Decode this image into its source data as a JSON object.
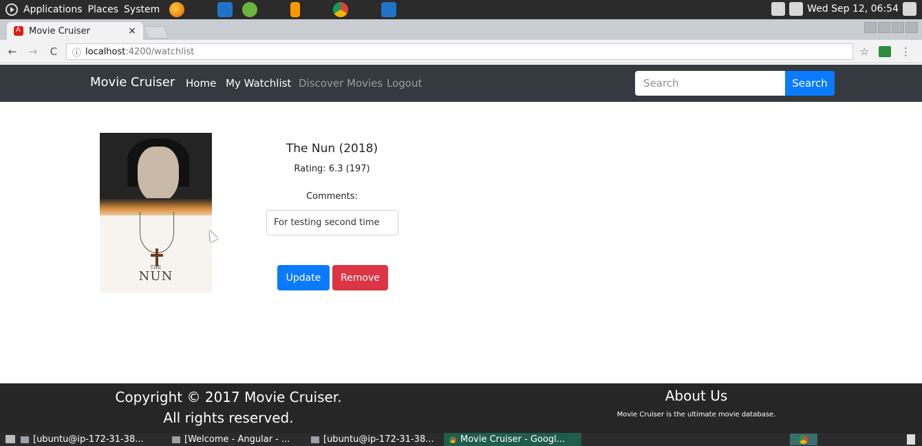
{
  "system_panel": {
    "menus": [
      "Applications",
      "Places",
      "System"
    ],
    "clock": "Wed Sep 12, 06:54"
  },
  "browser": {
    "tab_title": "Movie Cruiser",
    "tab_close": "×",
    "url_host": "localhost",
    "url_path": ":4200/watchlist",
    "back": "←",
    "forward": "→",
    "reload": "C",
    "info": "ⓘ",
    "star": "☆",
    "menu": "⋮"
  },
  "navbar": {
    "brand": "Movie Cruiser",
    "links": [
      "Home",
      "My Watchlist",
      "Discover Movies",
      "Logout"
    ],
    "search_placeholder": "Search",
    "search_button": "Search"
  },
  "movie": {
    "title": "The Nun (2018)",
    "rating": "Rating: 6.3 (197)",
    "comments_label": "Comments:",
    "comment_value": "For testing second time",
    "poster_text_small": "THE",
    "poster_text": "NUN",
    "update_label": "Update",
    "remove_label": "Remove"
  },
  "footer": {
    "copyright_line1": "Copyright © 2017 Movie Cruiser.",
    "copyright_line2": "All rights reserved.",
    "about_title": "About Us",
    "about_text": "Movie Cruiser is the ultimate movie database."
  },
  "taskbar": {
    "tasks": [
      "[ubuntu@ip-172-31-38...",
      "[Welcome - Angular - ...",
      "[ubuntu@ip-172-31-38...",
      "Movie Cruiser - Googl..."
    ]
  },
  "colors": {
    "navbar_bg": "#343a40",
    "primary": "#0a7bff",
    "danger": "#dc3545",
    "footer_bg": "#262626"
  }
}
